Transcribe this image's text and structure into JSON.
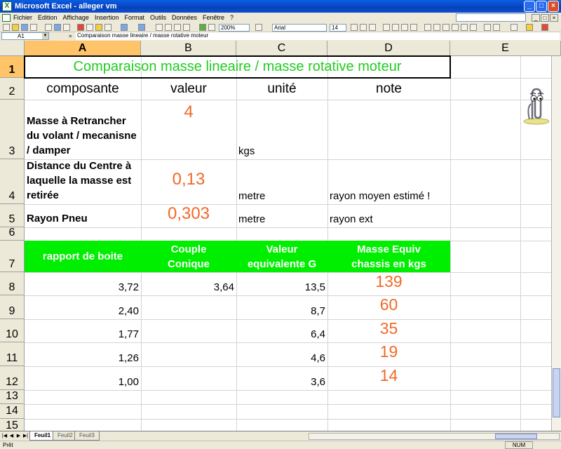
{
  "window": {
    "title": "Microsoft Excel - alleger vm",
    "app_icon_letter": "X",
    "minimize": "_",
    "maximize": "□",
    "close": "×"
  },
  "menu": {
    "items": [
      "Fichier",
      "Edition",
      "Affichage",
      "Insertion",
      "Format",
      "Outils",
      "Données",
      "Fenêtre",
      "?"
    ]
  },
  "toolbar": {
    "zoom": "200%",
    "font": "Arial",
    "size": "14"
  },
  "formula_bar": {
    "name_box": "A1",
    "fx": "=",
    "formula": "Comparaison masse lineaire / masse rotative moteur"
  },
  "columns": [
    "A",
    "B",
    "C",
    "D",
    "E"
  ],
  "rows": [
    "1",
    "2",
    "3",
    "4",
    "5",
    "6",
    "7",
    "8",
    "9",
    "10",
    "11",
    "12",
    "13",
    "14",
    "15"
  ],
  "sheet": {
    "title": "Comparaison masse lineaire / masse rotative moteur",
    "headers": [
      "composante",
      "valeur",
      "unité",
      "note"
    ],
    "params": [
      {
        "label": "Masse à Retrancher du volant / mecanisne / damper",
        "value": "4",
        "unit": "kgs",
        "note": ""
      },
      {
        "label": "Distance du Centre à laquelle la masse est retirée",
        "value": "0,13",
        "unit": "metre",
        "note": "rayon moyen estimé !"
      },
      {
        "label": "Rayon Pneu",
        "value": "0,303",
        "unit": "metre",
        "note": "rayon ext"
      }
    ],
    "table_headers": [
      "rapport de boite",
      "Couple Conique",
      "Valeur equivalente G",
      "Masse Equiv chassis en kgs"
    ],
    "table_rows": [
      {
        "rapport": "3,72",
        "couple": "3,64",
        "valeur": "13,5",
        "masse": "139"
      },
      {
        "rapport": "2,40",
        "couple": "",
        "valeur": "8,7",
        "masse": "60"
      },
      {
        "rapport": "1,77",
        "couple": "",
        "valeur": "6,4",
        "masse": "35"
      },
      {
        "rapport": "1,26",
        "couple": "",
        "valeur": "4,6",
        "masse": "19"
      },
      {
        "rapport": "1,00",
        "couple": "",
        "valeur": "3,6",
        "masse": "14"
      }
    ]
  },
  "tabs": [
    "Feuil1",
    "Feuil2",
    "Feuil3"
  ],
  "status": {
    "ready": "Prêt",
    "num": "NUM"
  }
}
